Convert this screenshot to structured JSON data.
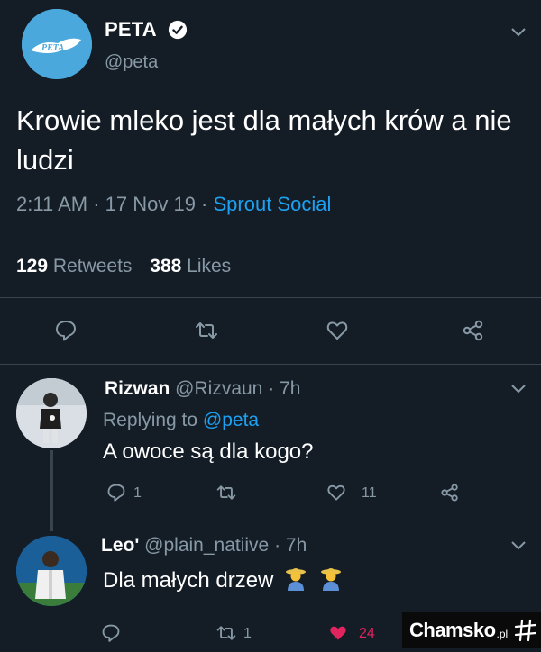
{
  "tweet": {
    "author_name": "PETA",
    "author_handle": "@peta",
    "logo_text": "PETA",
    "text": "Krowie mleko jest dla małych krów a nie ludzi",
    "time": "2:11 AM · 17 Nov 19 · ",
    "source": "Sprout Social",
    "retweets_count": "129",
    "retweets_label": " Retweets",
    "likes_count": "388",
    "likes_label": " Likes"
  },
  "replies": [
    {
      "name": "Rizwan",
      "handle_time": " @Rizvaun · 7h",
      "replying_prefix": "Replying to ",
      "replying_handle": "@peta",
      "text": "A owoce są dla kogo?",
      "reply_count": "1",
      "retweet_count": "",
      "like_count": "11"
    },
    {
      "name": "Leo'",
      "handle_time": " @plain_natiive · 7h",
      "text": "Dla małych drzew",
      "reply_count": "",
      "retweet_count": "1",
      "like_count": "24"
    }
  ],
  "watermark": {
    "text": "Chamsko",
    "suffix": ".pl"
  },
  "colors": {
    "background": "#141d26",
    "accent": "#1da1f2",
    "secondary_text": "#8899a6",
    "liked": "#e0245e"
  }
}
